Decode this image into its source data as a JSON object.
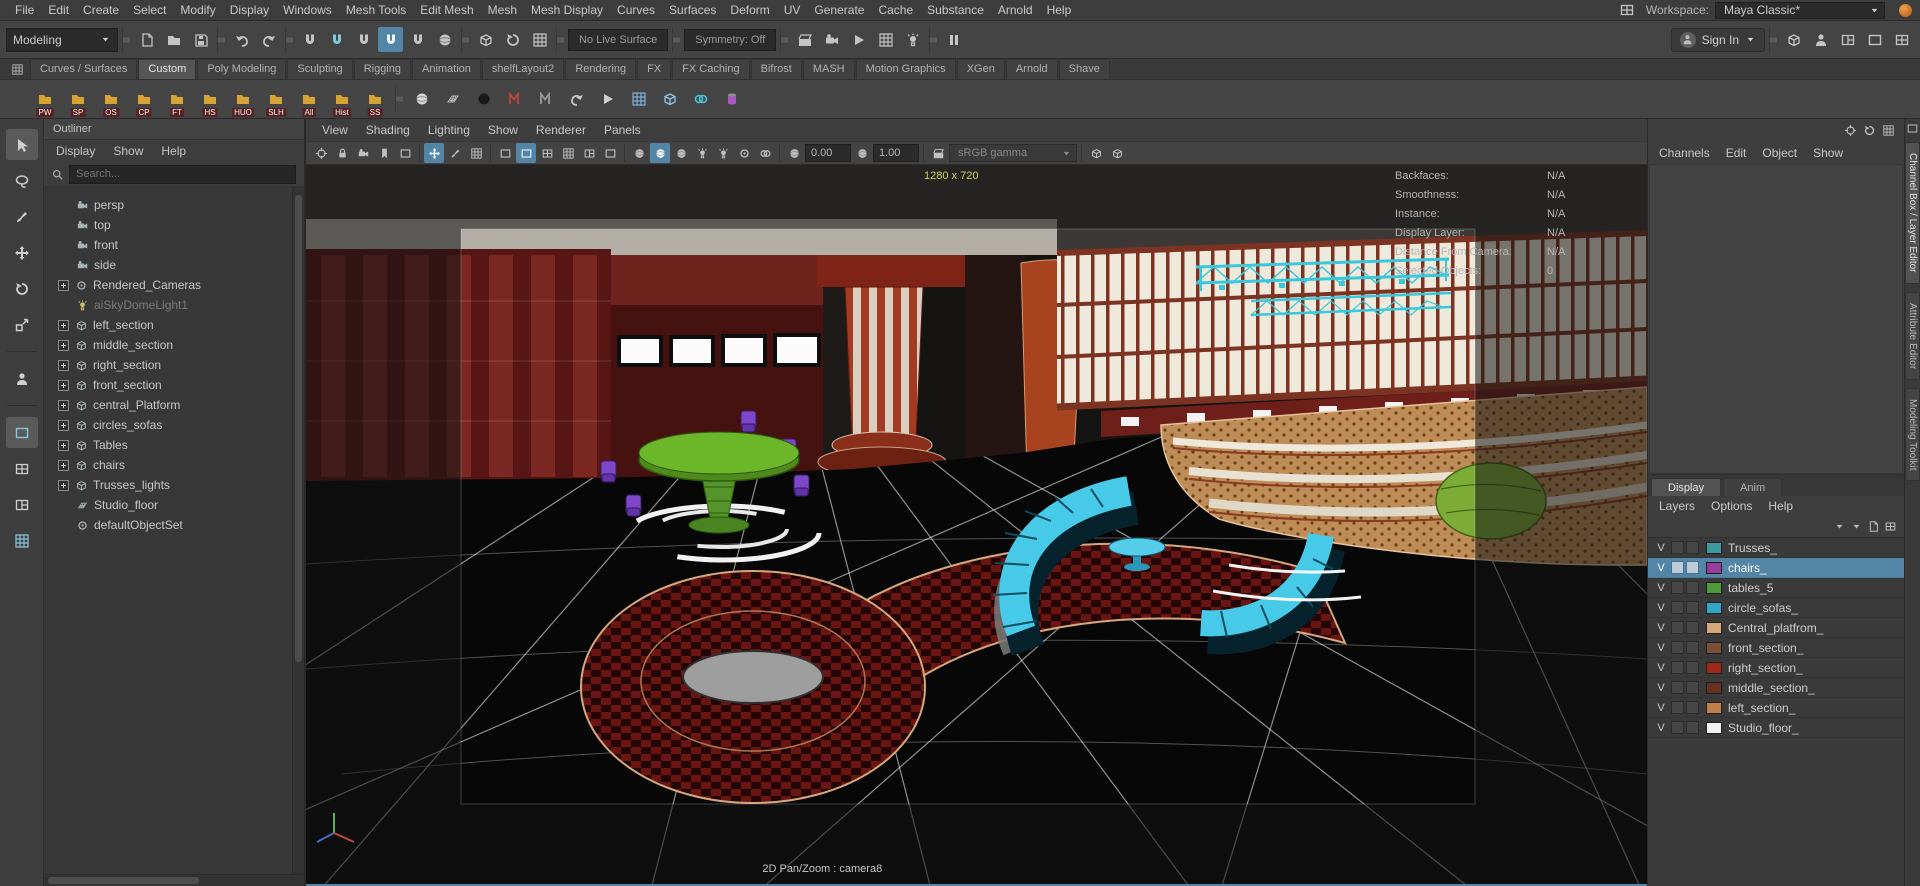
{
  "menubar": {
    "items": [
      "File",
      "Edit",
      "Create",
      "Select",
      "Modify",
      "Display",
      "Windows",
      "Mesh Tools",
      "Edit Mesh",
      "Mesh",
      "Mesh Display",
      "Curves",
      "Surfaces",
      "Deform",
      "UV",
      "Generate",
      "Cache",
      "Substance",
      "Arnold",
      "Help"
    ],
    "workspace_label": "Workspace:",
    "workspace_value": "Maya Classic*"
  },
  "statusline": {
    "menuset": "Modeling",
    "no_live_surface": "No Live Surface",
    "symmetry_label": "Symmetry: Off",
    "sign_in_label": "Sign In"
  },
  "shelf": {
    "tabs": [
      "Curves / Surfaces",
      "Custom",
      "Poly Modeling",
      "Sculpting",
      "Rigging",
      "Animation",
      "shelfLayout2",
      "Rendering",
      "FX",
      "FX Caching",
      "Bifrost",
      "MASH",
      "Motion Graphics",
      "XGen",
      "Arnold",
      "Shave"
    ],
    "active_tab": "Custom",
    "buttons": [
      "PW",
      "SP",
      "OS",
      "CP",
      "FT",
      "HS",
      "HUO",
      "SLH",
      "All",
      "Hist",
      "SS"
    ]
  },
  "outliner": {
    "title": "Outliner",
    "menus": [
      "Display",
      "Show",
      "Help"
    ],
    "search_placeholder": "Search...",
    "items": [
      {
        "label": "persp",
        "icon": "camera"
      },
      {
        "label": "top",
        "icon": "camera"
      },
      {
        "label": "front",
        "icon": "camera"
      },
      {
        "label": "side",
        "icon": "camera"
      },
      {
        "label": "Rendered_Cameras",
        "icon": "group",
        "expandable": true
      },
      {
        "label": "aiSkyDomeLight1",
        "icon": "light",
        "dimmed": true
      },
      {
        "label": "left_section",
        "icon": "mesh",
        "expandable": true
      },
      {
        "label": "middle_section",
        "icon": "mesh",
        "expandable": true
      },
      {
        "label": "right_section",
        "icon": "mesh",
        "expandable": true
      },
      {
        "label": "front_section",
        "icon": "mesh",
        "expandable": true
      },
      {
        "label": "central_Platform",
        "icon": "mesh",
        "expandable": true
      },
      {
        "label": "circles_sofas",
        "icon": "mesh",
        "expandable": true
      },
      {
        "label": "Tables",
        "icon": "mesh",
        "expandable": true
      },
      {
        "label": "chairs",
        "icon": "mesh",
        "expandable": true
      },
      {
        "label": "Trusses_lights",
        "icon": "mesh",
        "expandable": true
      },
      {
        "label": "Studio_floor",
        "icon": "plane"
      },
      {
        "label": "defaultObjectSet",
        "icon": "set"
      }
    ]
  },
  "viewport": {
    "menus": [
      "View",
      "Shading",
      "Lighting",
      "Show",
      "Renderer",
      "Panels"
    ],
    "resolution_label": "1280 x 720",
    "camera_label": "2D Pan/Zoom : camera8",
    "exposure": "0.00",
    "gamma": "1.00",
    "view_transform": "sRGB gamma",
    "hud": [
      {
        "label": "Backfaces:",
        "value": "N/A"
      },
      {
        "label": "Smoothness:",
        "value": "N/A"
      },
      {
        "label": "Instance:",
        "value": "N/A"
      },
      {
        "label": "Display Layer:",
        "value": "N/A"
      },
      {
        "label": "Distance From Camera:",
        "value": "N/A"
      },
      {
        "label": "Selected Objects:",
        "value": "0"
      }
    ]
  },
  "channel_box": {
    "menus": [
      "Channels",
      "Edit",
      "Object",
      "Show"
    ]
  },
  "layer_editor": {
    "tabs": [
      "Display",
      "Anim"
    ],
    "menus": [
      "Layers",
      "Options",
      "Help"
    ],
    "layers": [
      {
        "v": "V",
        "name": "Trusses_",
        "color": "#3d9aa0",
        "selected": false
      },
      {
        "v": "V",
        "name": "chairs_",
        "color": "#9a3da0",
        "selected": true
      },
      {
        "v": "V",
        "name": "tables_5",
        "color": "#4f9a39",
        "selected": false
      },
      {
        "v": "V",
        "name": "circle_sofas_",
        "color": "#2fa8c8",
        "selected": false
      },
      {
        "v": "V",
        "name": "Central_platfrom_",
        "color": "#d8a87a",
        "selected": false
      },
      {
        "v": "V",
        "name": "front_section_",
        "color": "#7a5036",
        "selected": false
      },
      {
        "v": "V",
        "name": "right_section_",
        "color": "#a02818",
        "selected": false
      },
      {
        "v": "V",
        "name": "middle_section_",
        "color": "#68301e",
        "selected": false
      },
      {
        "v": "V",
        "name": "left_section_",
        "color": "#c08048",
        "selected": false
      },
      {
        "v": "V",
        "name": "Studio_floor_",
        "color": "#f2f2f2",
        "selected": false
      }
    ]
  },
  "right_strip": {
    "tabs": [
      "Channel Box / Layer Editor",
      "Attribute Editor",
      "Modeling Toolkit"
    ]
  }
}
